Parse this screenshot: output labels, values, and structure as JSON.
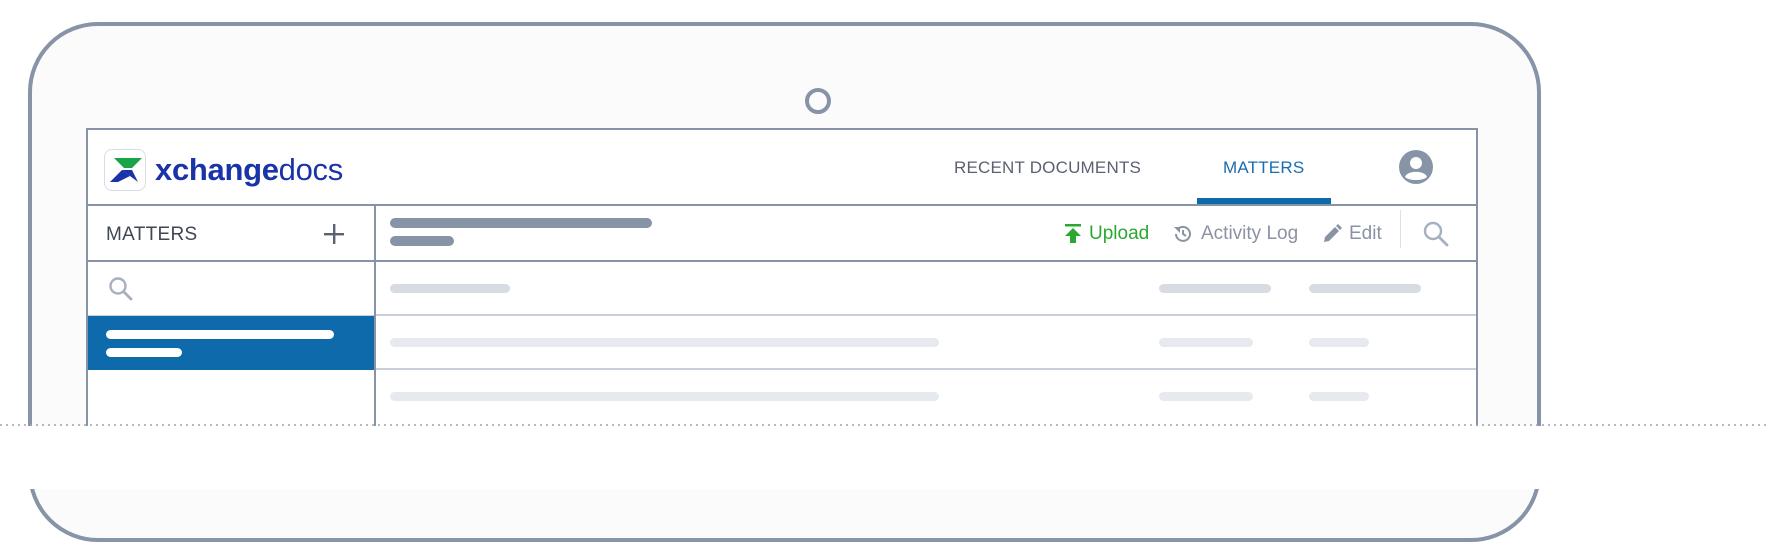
{
  "brand": {
    "name_bold": "xchange",
    "name_light": "docs",
    "colors": {
      "primary": "#1a33a8",
      "green": "#1ba34a",
      "accent": "#0f6aab"
    }
  },
  "nav": {
    "items": [
      {
        "label": "RECENT DOCUMENTS",
        "active": false
      },
      {
        "label": "MATTERS",
        "active": true
      }
    ],
    "avatar_icon": "user-circle-icon"
  },
  "sidebar": {
    "title": "MATTERS",
    "add_icon": "plus-icon",
    "search_icon": "search-icon"
  },
  "toolbar": {
    "upload_label": "Upload",
    "activity_log_label": "Activity Log",
    "edit_label": "Edit",
    "upload_color": "#2aa832",
    "search_icon": "search-icon"
  },
  "colors": {
    "frame": "#8793a6",
    "selected_bg": "#0f6aab",
    "placeholder_dark": "#d7dbe2",
    "placeholder_light": "#e6e9ee"
  }
}
